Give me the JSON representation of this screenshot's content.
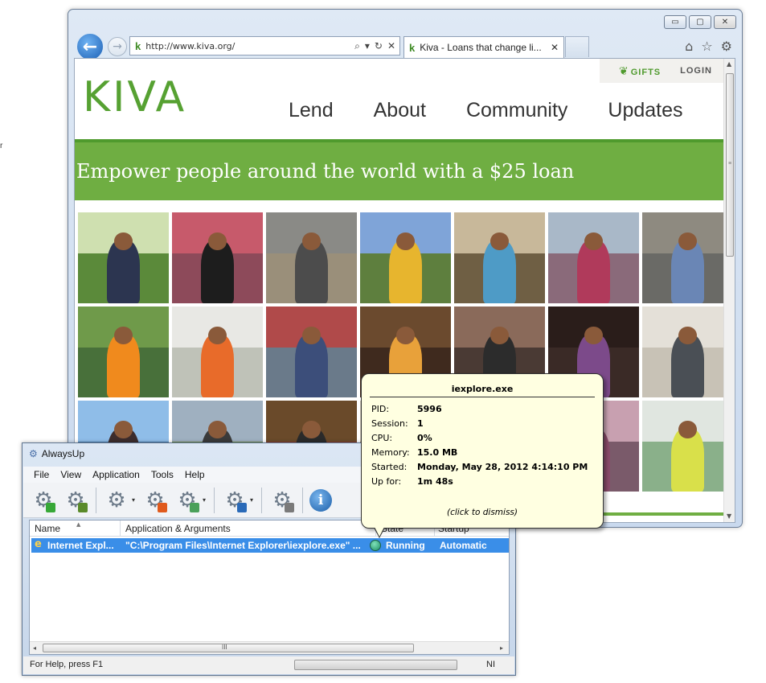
{
  "stray_mark": "r",
  "browser": {
    "url": "http://www.kiva.org/",
    "tab_title": "Kiva - Loans that change li...",
    "controls": {
      "minimize": "▭",
      "maximize": "▢",
      "close": "✕"
    },
    "icons": {
      "back": "←",
      "forward": "→",
      "search": "⌕",
      "dropdown": "▾",
      "refresh": "↻",
      "stop": "✕",
      "tab_close": "✕",
      "home": "⌂",
      "favorites": "☆",
      "tools": "⚙",
      "favicon": "k"
    }
  },
  "kiva": {
    "gifts": "GIFTS",
    "login": "LOGIN",
    "logo": "KIVA",
    "nav": [
      "Lend",
      "About",
      "Community",
      "Updates"
    ],
    "banner": "Empower people around the world with a $25 loan",
    "brand_green": "#6fae42"
  },
  "photos": [
    {
      "sky": "#cfe0b0",
      "ground": "#5b8a3a",
      "figure": "#2c3550"
    },
    {
      "sky": "#c75a6b",
      "ground": "#8d4a5a",
      "figure": "#1d1d1d"
    },
    {
      "sky": "#8a8a86",
      "ground": "#9a8f7a",
      "figure": "#4c4c4c"
    },
    {
      "sky": "#7fa4d8",
      "ground": "#5e7f3e",
      "figure": "#e7b52e"
    },
    {
      "sky": "#c8b89a",
      "ground": "#6f5f44",
      "figure": "#4e9bc6"
    },
    {
      "sky": "#a9b8c8",
      "ground": "#8a6a7a",
      "figure": "#b03a5b"
    },
    {
      "sky": "#8e8a80",
      "ground": "#6a6a66",
      "figure": "#6a86b5"
    },
    {
      "sky": "#6f9a4a",
      "ground": "#48703a",
      "figure": "#f08a1d"
    },
    {
      "sky": "#e8e8e4",
      "ground": "#bfc2b8",
      "figure": "#e86b2a"
    },
    {
      "sky": "#b04a4a",
      "ground": "#6a7a8a",
      "figure": "#3c4e7a"
    },
    {
      "sky": "#6b4a2e",
      "ground": "#3f2a1e",
      "figure": "#e8a13a"
    },
    {
      "sky": "#8a6a5a",
      "ground": "#4a3a34",
      "figure": "#2c2c2c"
    },
    {
      "sky": "#2a1d1a",
      "ground": "#3a2a26",
      "figure": "#7c4a8a"
    },
    {
      "sky": "#e4e0d8",
      "ground": "#c8c2b6",
      "figure": "#4a4f55"
    },
    {
      "sky": "#8fbde8",
      "ground": "#4d7aa8",
      "figure": "#3c2c2c"
    },
    {
      "sky": "#9fb0c0",
      "ground": "#6f8a4a",
      "figure": "#3a3a3a"
    },
    {
      "sky": "#6a4a2a",
      "ground": "#8a3a2a",
      "figure": "#2a2a2a"
    },
    {
      "sky": "#c8c0b0",
      "ground": "#8a7a6a",
      "figure": "#5a5a5a"
    },
    {
      "sky": "#9a8a7a",
      "ground": "#6a5a4a",
      "figure": "#7a6a5a"
    },
    {
      "sky": "#c8a0b0",
      "ground": "#7a5a6a",
      "figure": "#8a4a6a"
    },
    {
      "sky": "#e0e6e0",
      "ground": "#8ab08a",
      "figure": "#d9e04a"
    }
  ],
  "alwaysup": {
    "title": "AlwaysUp",
    "menu": [
      "File",
      "View",
      "Application",
      "Tools",
      "Help"
    ],
    "toolbar": {
      "add_badge": "#37a837",
      "edit_badge": "#5a8a2a",
      "start_badge": "#e05a1c",
      "restart_badge": "#4aa05a",
      "report_badge": "#2a6ab8",
      "remove_badge": "#7a7a7a",
      "gear": "⚙",
      "dropdown": "▾",
      "info": "i"
    },
    "columns": {
      "name": "Name",
      "app": "Application & Arguments",
      "state": "State",
      "startup": "Startup"
    },
    "row": {
      "name": "Internet Expl...",
      "app": "\"C:\\Program Files\\Internet Explorer\\iexplore.exe\" ...",
      "state": "Running",
      "startup": "Automatic",
      "icon": "e"
    },
    "status": {
      "help": "For Help, press F1",
      "ni": "NI"
    },
    "scroll_arrows": {
      "left": "◂",
      "right": "▸",
      "grip": "III"
    }
  },
  "tooltip": {
    "title": "iexplore.exe",
    "rows": [
      {
        "label": "PID:",
        "value": "5996"
      },
      {
        "label": "Session:",
        "value": "1"
      },
      {
        "label": "CPU:",
        "value": "0%"
      },
      {
        "label": "Memory:",
        "value": "15.0 MB"
      },
      {
        "label": "Started:",
        "value": "Monday, May 28, 2012 4:14:10 PM"
      },
      {
        "label": "Up for:",
        "value": "1m 48s"
      }
    ],
    "dismiss": "(click to dismiss)"
  }
}
